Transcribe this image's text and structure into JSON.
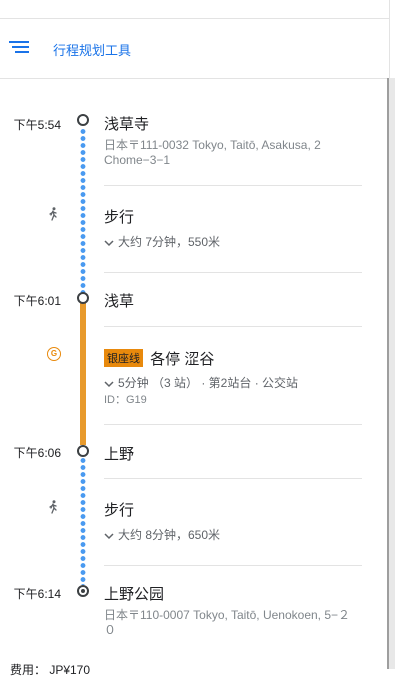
{
  "header": {
    "title": "行程规划工具",
    "menu_icon": "menu-icon"
  },
  "stops": [
    {
      "time": "下午5:54",
      "name": "浅草寺",
      "address": "日本〒111-0032 Tokyo, Taitō, Asakusa, 2 Chome−3−1"
    },
    {
      "time": "下午6:01",
      "name": "浅草"
    },
    {
      "time": "下午6:06",
      "name": "上野"
    },
    {
      "time": "下午6:14",
      "name": "上野公园",
      "address": "日本〒110-0007 Tokyo, Taitō, Uenokoen, 5−２０"
    }
  ],
  "walk1": {
    "mode": "步行",
    "detail": "大约 7分钟，550米"
  },
  "transit": {
    "badge": "G",
    "line_name": "银座线",
    "service": "各停",
    "destination": "涩谷",
    "detail": "5分钟 （3 站） · 第2站台 · 公交站",
    "stop_id": "ID：G19",
    "line_color": "#e8890c"
  },
  "walk2": {
    "mode": "步行",
    "detail": "大约 8分钟，650米"
  },
  "fare": "费用： JP¥170",
  "colors": {
    "accent": "#1a73e8",
    "walk_dots": "#4a9af0",
    "rail_line": "#e89a2c"
  }
}
